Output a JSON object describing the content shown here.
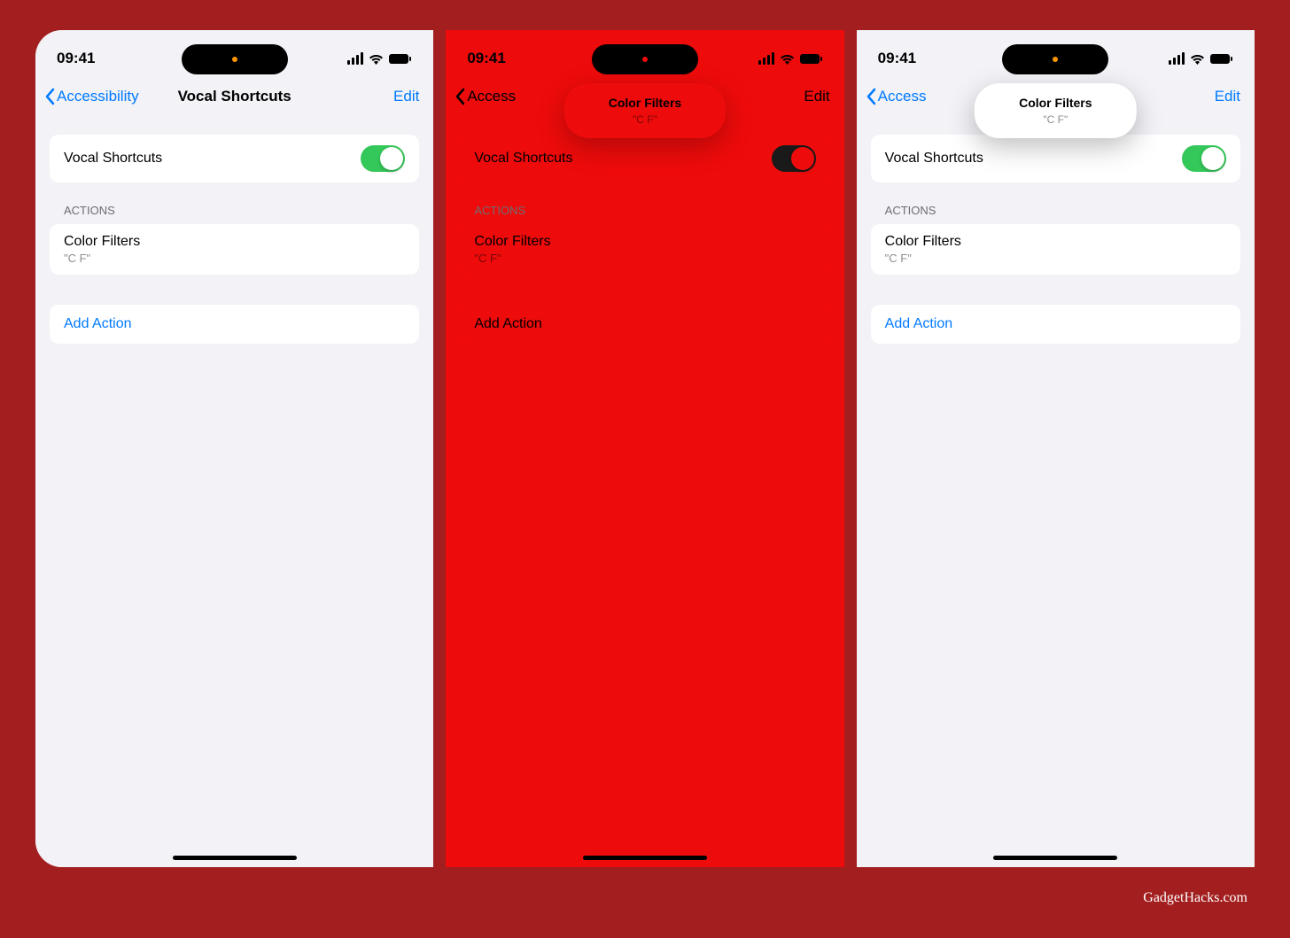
{
  "attribution": "GadgetHacks.com",
  "status": {
    "time": "09:41"
  },
  "nav": {
    "back_label": "Accessibility",
    "back_label_short": "Access",
    "title": "Vocal Shortcuts",
    "edit": "Edit"
  },
  "toggle": {
    "label": "Vocal Shortcuts"
  },
  "actions": {
    "header": "Actions",
    "items": [
      {
        "title": "Color Filters",
        "subtitle": "\"C F\""
      }
    ],
    "add": "Add Action"
  },
  "popover": {
    "title": "Color Filters",
    "subtitle": "\"C F\""
  }
}
